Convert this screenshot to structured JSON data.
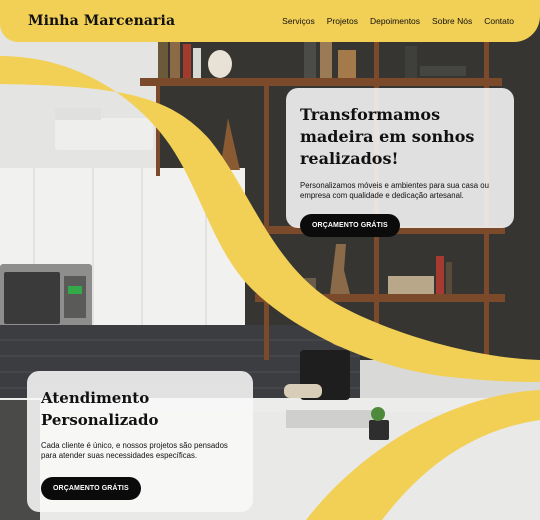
{
  "brand": "Minha Marcenaria",
  "nav": {
    "items": [
      "Serviços",
      "Projetos",
      "Depoimentos",
      "Sobre Nós",
      "Contato"
    ]
  },
  "hero": {
    "title": "Transformamos madeira em sonhos realizados!",
    "text": "Personalizamos móveis e ambientes para sua casa ou empresa com qualidade e dedicação artesanal.",
    "button": "ORÇAMENTO GRÁTIS"
  },
  "feature": {
    "title": "Atendimento Personalizado",
    "text": "Cada cliente é único, e nossos projetos são pensados para atender suas necessidades específicas.",
    "button": "ORÇAMENTO GRÁTIS"
  },
  "colors": {
    "accent": "#f2cf55",
    "button": "#0b0b0b",
    "card": "#f8f8f8"
  }
}
